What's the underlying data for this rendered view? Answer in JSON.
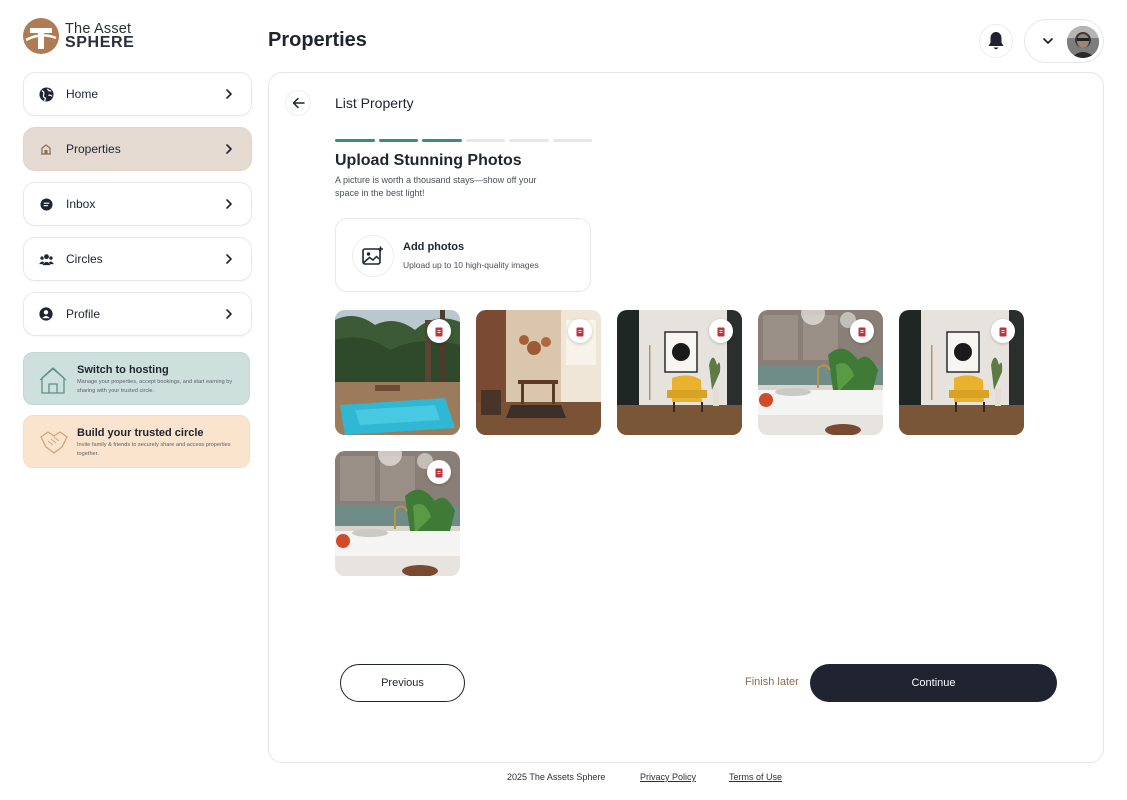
{
  "brand": {
    "line1": "The Asset",
    "line2": "SPHERE",
    "logo_icon": "asset-sphere-logo",
    "accent": "#b07a52"
  },
  "header": {
    "title": "Properties",
    "notification_icon": "bell-icon",
    "menu_icon": "chevron-down-icon"
  },
  "sidebar": {
    "items": [
      {
        "label": "Home",
        "icon": "globe-icon",
        "active": false
      },
      {
        "label": "Properties",
        "icon": "building-icon",
        "active": true
      },
      {
        "label": "Inbox",
        "icon": "chat-icon",
        "active": false
      },
      {
        "label": "Circles",
        "icon": "people-icon",
        "active": false
      },
      {
        "label": "Profile",
        "icon": "user-icon",
        "active": false
      }
    ],
    "promos": [
      {
        "title": "Switch to hosting",
        "desc": "Manage your properties, accept bookings, and start earning by sharing with your trusted circle.",
        "color": "#cde0dc"
      },
      {
        "title": "Build your trusted circle",
        "desc": "Invite family & friends to securely share and access properties together.",
        "color": "#fbe4cd"
      }
    ]
  },
  "main": {
    "title": "List Property",
    "step_progress": {
      "completed": 3,
      "total": 6,
      "color": "#3d8b79"
    },
    "section_title": "Upload Stunning Photos",
    "section_sub": "A picture is worth a thousand stays—show off your space in the best light!",
    "add_photos": {
      "title": "Add photos",
      "subtitle": "Upload up to 10 high-quality images"
    },
    "photos": [
      {
        "scene": "pool",
        "delete_icon": "trash-icon"
      },
      {
        "scene": "dining",
        "delete_icon": "trash-icon"
      },
      {
        "scene": "chair",
        "delete_icon": "trash-icon"
      },
      {
        "scene": "kitchen",
        "delete_icon": "trash-icon"
      },
      {
        "scene": "chair",
        "delete_icon": "trash-icon"
      },
      {
        "scene": "kitchen",
        "delete_icon": "trash-icon"
      }
    ],
    "buttons": {
      "previous": "Previous",
      "finish_later": "Finish later",
      "continue": "Continue"
    }
  },
  "footer": {
    "copyright": "2025 The Assets Sphere",
    "privacy": "Privacy Policy",
    "terms": "Terms of Use"
  }
}
